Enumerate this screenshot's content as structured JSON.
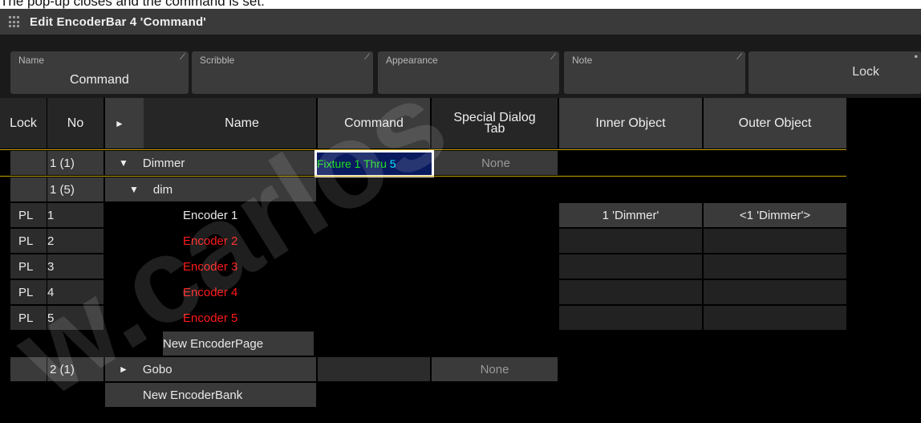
{
  "caption": "The pop-up closes and the command is set.",
  "window": {
    "title": "Edit EncoderBar 4 'Command'",
    "icon": "grid-icon"
  },
  "fields": {
    "name_label": "Name",
    "name_value": "Command",
    "scribble_label": "Scribble",
    "appearance_label": "Appearance",
    "note_label": "Note",
    "lock_value": "Lock"
  },
  "columns": {
    "lock": "Lock",
    "no": "No",
    "expand": "►",
    "name": "Name",
    "command": "Command",
    "special_dialog_tab": "Special Dialog Tab",
    "inner_object": "Inner Object",
    "outer_object": "Outer Object"
  },
  "rows": {
    "dimmer_bank": {
      "no": "1 (1)",
      "expand": "▼",
      "name": "Dimmer",
      "command_green": "Fixture 1 Thru",
      "command_cyan": "5",
      "special": "None"
    },
    "dim_page": {
      "no": "1 (5)",
      "expand": "▼",
      "name": "dim"
    },
    "encoders": [
      {
        "lock": "PL",
        "no": "1",
        "name": "Encoder 1",
        "inner": "1 'Dimmer'",
        "outer": "<1 'Dimmer'>"
      },
      {
        "lock": "PL",
        "no": "2",
        "name": "Encoder 2",
        "inner": "",
        "outer": ""
      },
      {
        "lock": "PL",
        "no": "3",
        "name": "Encoder 3",
        "inner": "",
        "outer": ""
      },
      {
        "lock": "PL",
        "no": "4",
        "name": "Encoder 4",
        "inner": "",
        "outer": ""
      },
      {
        "lock": "PL",
        "no": "5",
        "name": "Encoder 5",
        "inner": "",
        "outer": ""
      }
    ],
    "new_encoder_page": "New EncoderPage",
    "gobo_bank": {
      "no": "2 (1)",
      "expand": "►",
      "name": "Gobo",
      "special": "None"
    },
    "new_encoder_bank": "New EncoderBank"
  },
  "watermark": "w.carlos",
  "colors": {
    "title_bar": "#3a3a3a",
    "selection_fill": "#0a1a5e",
    "command_green": "#20e020",
    "command_cyan": "#00e5ff",
    "error_red": "#ff1a1a",
    "gold_separator": "#c8a000"
  }
}
